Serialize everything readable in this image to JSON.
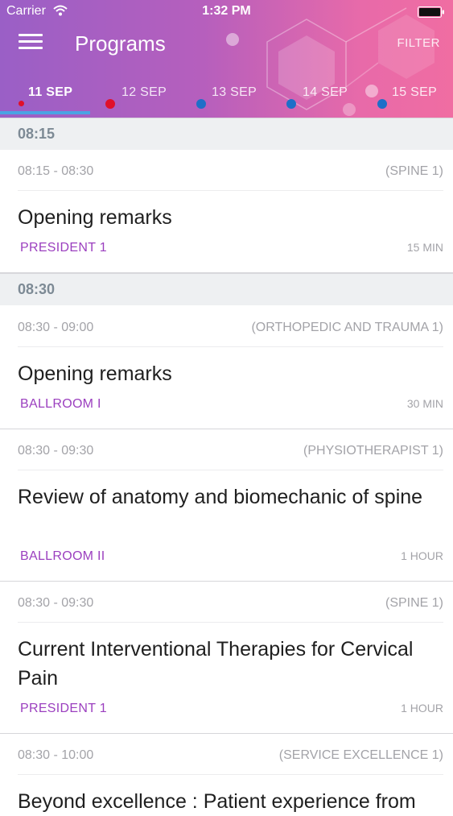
{
  "status_bar": {
    "carrier": "Carrier",
    "time": "1:32 PM"
  },
  "header": {
    "title": "Programs",
    "filter_label": "FILTER"
  },
  "colors": {
    "accent": "#9b3fbf",
    "tab_indicator": "#4ba3e3",
    "dot_red": "#e0102a",
    "dot_blue": "#1e6fc8"
  },
  "tabs": [
    {
      "label": "11 SEP",
      "active": true,
      "dot": "red-small"
    },
    {
      "label": "12 SEP",
      "active": false,
      "dot": "red"
    },
    {
      "label": "13 SEP",
      "active": false,
      "dot": "blue"
    },
    {
      "label": "14 SEP",
      "active": false,
      "dot": "blue"
    },
    {
      "label": "15 SEP",
      "active": false,
      "dot": "blue"
    }
  ],
  "sections": [
    {
      "time": "08:15",
      "sessions": [
        {
          "time_range": "08:15 - 08:30",
          "track": "(SPINE 1)",
          "title": "Opening remarks",
          "room": "PRESIDENT 1",
          "duration": "15 MIN"
        }
      ]
    },
    {
      "time": "08:30",
      "sessions": [
        {
          "time_range": "08:30 - 09:00",
          "track": "(ORTHOPEDIC AND TRAUMA 1)",
          "title": "Opening remarks",
          "room": "BALLROOM I",
          "duration": "30 MIN"
        },
        {
          "time_range": "08:30 - 09:30",
          "track": "(PHYSIOTHERAPIST 1)",
          "title": "Review of anatomy and biomechanic of spine",
          "room": "BALLROOM II",
          "duration": "1 HOUR"
        },
        {
          "time_range": "08:30 - 09:30",
          "track": "(SPINE 1)",
          "title": "Current Interventional Therapies for Cervical Pain",
          "room": "PRESIDENT 1",
          "duration": "1 HOUR"
        },
        {
          "time_range": "08:30 - 10:00",
          "track": "(SERVICE EXCELLENCE 1)",
          "title": "Beyond excellence : Patient experience from",
          "room": "",
          "duration": ""
        }
      ]
    }
  ]
}
